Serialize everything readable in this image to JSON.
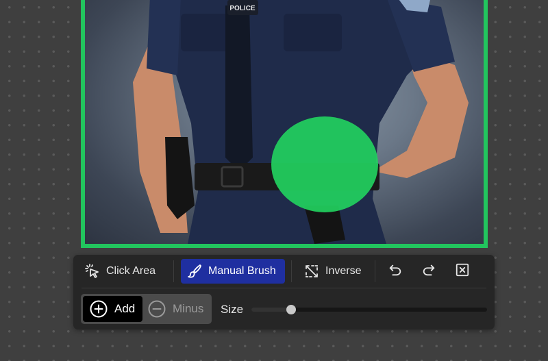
{
  "canvas": {
    "image_alt": "Police officer in navy uniform with hand on hip",
    "badge_text": "POLICE",
    "frame_color": "#22c55e",
    "mask_color": "#22d05e"
  },
  "toolbar": {
    "modes": [
      {
        "id": "click-area",
        "label": "Click Area",
        "icon": "cursor-click-icon",
        "active": false
      },
      {
        "id": "manual-brush",
        "label": "Manual Brush",
        "icon": "brush-icon",
        "active": true
      },
      {
        "id": "inverse",
        "label": "Inverse",
        "icon": "inverse-selection-icon",
        "active": false
      }
    ],
    "actions": [
      {
        "id": "undo",
        "icon": "undo-icon"
      },
      {
        "id": "redo",
        "icon": "redo-icon"
      },
      {
        "id": "clear",
        "icon": "clear-icon"
      }
    ],
    "brush_mode": {
      "add_label": "Add",
      "minus_label": "Minus",
      "selected": "Add"
    },
    "size": {
      "label": "Size",
      "value_fraction": 0.17
    },
    "accent_color": "#1f2fa0"
  }
}
